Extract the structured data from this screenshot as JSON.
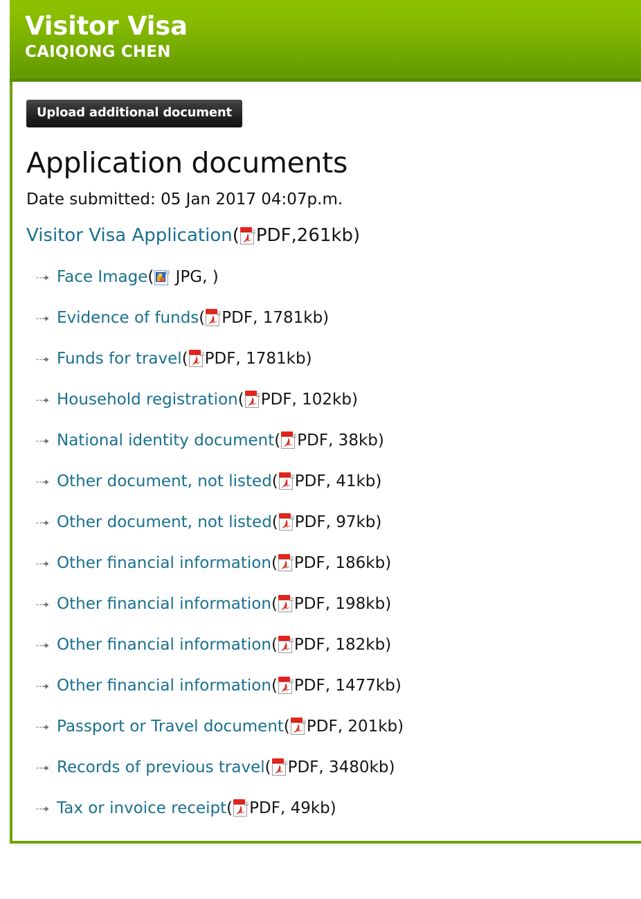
{
  "banner": {
    "title": "Visitor Visa",
    "subtitle": "CAIQIONG CHEN",
    "gradient_top_color": "#8ec200",
    "gradient_bottom_color": "#538800",
    "border_color": "#6fa400"
  },
  "toolbar": {
    "upload_label": "Upload additional document"
  },
  "main": {
    "page_title": "Application documents",
    "date_submitted_label": "Date submitted: 05 Jan 2017  04:07p.m.",
    "link_color": "#19708f"
  },
  "primary_document": {
    "name": "Visitor Visa Application",
    "open_paren": "(",
    "icon": "pdf-icon",
    "meta": "PDF,261kb",
    "close_paren": ")"
  },
  "documents": [
    {
      "name": "Face Image",
      "icon": "jpg-icon",
      "meta": " JPG, "
    },
    {
      "name": "Evidence of funds",
      "icon": "pdf-icon",
      "meta": "PDF, 1781kb"
    },
    {
      "name": "Funds for travel",
      "icon": "pdf-icon",
      "meta": "PDF, 1781kb"
    },
    {
      "name": "Household registration",
      "icon": "pdf-icon",
      "meta": "PDF, 102kb"
    },
    {
      "name": "National identity document",
      "icon": "pdf-icon",
      "meta": "PDF, 38kb"
    },
    {
      "name": "Other document, not listed",
      "icon": "pdf-icon",
      "meta": "PDF, 41kb"
    },
    {
      "name": "Other document, not listed",
      "icon": "pdf-icon",
      "meta": "PDF, 97kb"
    },
    {
      "name": "Other financial information",
      "icon": "pdf-icon",
      "meta": "PDF, 186kb"
    },
    {
      "name": "Other financial information",
      "icon": "pdf-icon",
      "meta": "PDF, 198kb"
    },
    {
      "name": "Other financial information",
      "icon": "pdf-icon",
      "meta": "PDF, 182kb"
    },
    {
      "name": "Other financial information",
      "icon": "pdf-icon",
      "meta": "PDF, 1477kb"
    },
    {
      "name": "Passport or Travel document",
      "icon": "pdf-icon",
      "meta": "PDF, 201kb"
    },
    {
      "name": "Records of previous travel",
      "icon": "pdf-icon",
      "meta": "PDF, 3480kb"
    },
    {
      "name": "Tax or invoice receipt",
      "icon": "pdf-icon",
      "meta": "PDF, 49kb"
    }
  ],
  "punctuation": {
    "open_paren": "(",
    "close_paren": ")"
  }
}
